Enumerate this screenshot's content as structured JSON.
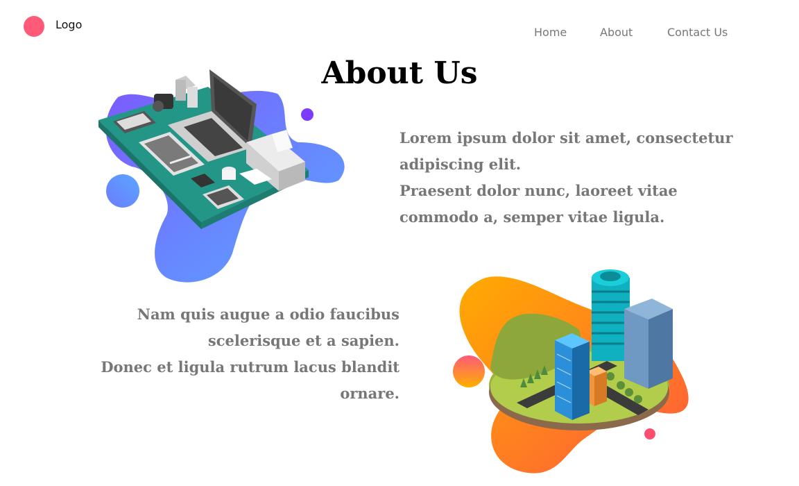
{
  "header": {
    "logo_label": "Logo",
    "nav": [
      {
        "label": "Home"
      },
      {
        "label": "About"
      },
      {
        "label": "Contact Us"
      }
    ]
  },
  "main": {
    "title": "About Us",
    "paragraph_1": "Lorem ipsum dolor sit amet, consectetur adipiscing elit.\nPraesent dolor nunc, laoreet vitae commodo a, semper vitae ligula.",
    "paragraph_2": "Nam quis augue a odio faucibus scelerisque et a sapien.\nDonec et ligula rutrum lacus blandit ornare."
  },
  "colors": {
    "logo": "#ff5a78",
    "text_muted": "#777777",
    "blob_blue": "#5b8cff",
    "blob_purple": "#7a5cff",
    "blob_orange": "#ff8a2b",
    "blob_pink": "#ff5a78",
    "desk_teal": "#239688"
  }
}
